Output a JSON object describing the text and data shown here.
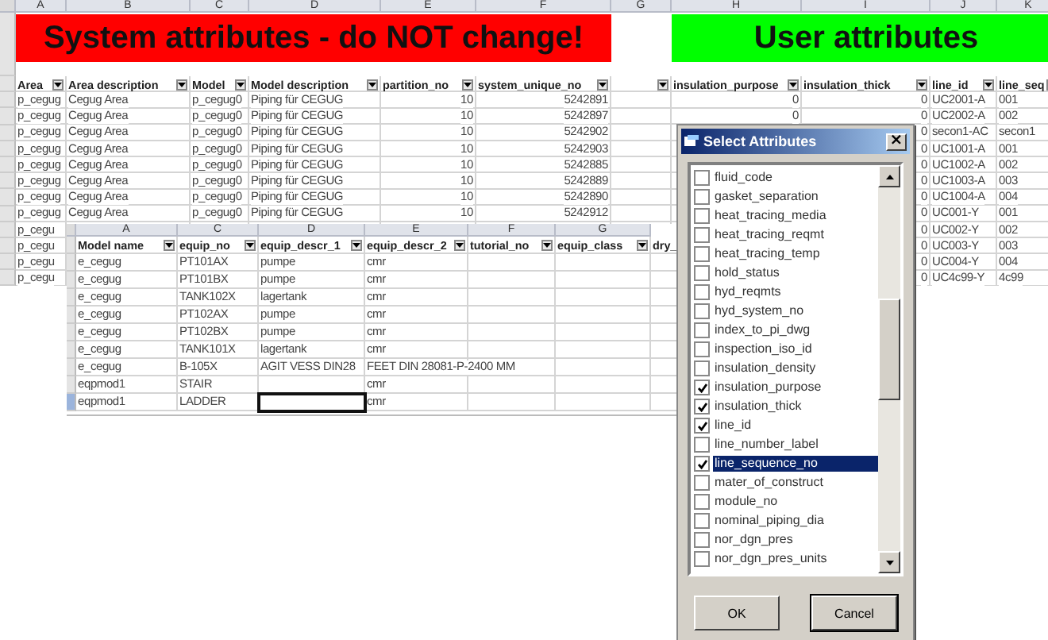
{
  "back_sheet": {
    "column_letters": [
      "A",
      "B",
      "C",
      "D",
      "E",
      "F",
      "G",
      "H",
      "I",
      "J",
      "K"
    ],
    "banners": [
      {
        "text": "System attributes - do NOT change!",
        "color": "#ff0000"
      },
      {
        "text": "User attributes",
        "color": "#00ff00"
      }
    ],
    "columns": [
      {
        "label": "Area"
      },
      {
        "label": "Area description"
      },
      {
        "label": "Model"
      },
      {
        "label": "Model description"
      },
      {
        "label": "partition_no"
      },
      {
        "label": "system_unique_no"
      },
      {},
      {
        "label": "insulation_purpose"
      },
      {
        "label": "insulation_thick"
      },
      {
        "label": "line_id"
      },
      {
        "label": "line_seq"
      }
    ],
    "rows": [
      {
        "cells": [
          "p_cegug",
          "Cegug Area",
          "p_cegug0",
          "Piping für CEGUG",
          "10",
          "5242891",
          null,
          "0",
          "0",
          "UC2001-A",
          "001"
        ]
      },
      {
        "cells": [
          "p_cegug",
          "Cegug Area",
          "p_cegug0",
          "Piping für CEGUG",
          "10",
          "5242897",
          null,
          "0",
          "0",
          "UC2002-A",
          "002"
        ]
      },
      {
        "cells": [
          "p_cegug",
          "Cegug Area",
          "p_cegug0",
          "Piping für CEGUG",
          "10",
          "5242902",
          null,
          null,
          "0",
          "secon1-AC",
          "secon1"
        ]
      },
      {
        "cells": [
          "p_cegug",
          "Cegug Area",
          "p_cegug0",
          "Piping für CEGUG",
          "10",
          "5242903",
          null,
          null,
          "0",
          "UC1001-A",
          "001"
        ]
      },
      {
        "cells": [
          "p_cegug",
          "Cegug Area",
          "p_cegug0",
          "Piping für CEGUG",
          "10",
          "5242885",
          null,
          null,
          "0",
          "UC1002-A",
          "002"
        ]
      },
      {
        "cells": [
          "p_cegug",
          "Cegug Area",
          "p_cegug0",
          "Piping für CEGUG",
          "10",
          "5242889",
          null,
          null,
          "0",
          "UC1003-A",
          "003"
        ]
      },
      {
        "cells": [
          "p_cegug",
          "Cegug Area",
          "p_cegug0",
          "Piping für CEGUG",
          "10",
          "5242890",
          null,
          null,
          "0",
          "UC1004-A",
          "004"
        ]
      },
      {
        "cells": [
          "p_cegug",
          "Cegug Area",
          "p_cegug0",
          "Piping für CEGUG",
          "10",
          "5242912",
          null,
          null,
          "0",
          "UC001-Y",
          "001"
        ]
      },
      {
        "cells": [
          "p_cegu",
          null,
          null,
          null,
          null,
          null,
          null,
          null,
          "0",
          "UC002-Y",
          "002"
        ]
      },
      {
        "cells": [
          "p_cegu",
          null,
          null,
          null,
          null,
          null,
          null,
          null,
          "0",
          "UC003-Y",
          "003"
        ]
      },
      {
        "cells": [
          "p_cegu",
          null,
          null,
          null,
          null,
          null,
          null,
          null,
          "0",
          "UC004-Y",
          "004"
        ]
      },
      {
        "cells": [
          "p_cegu",
          null,
          null,
          null,
          null,
          null,
          null,
          null,
          "0",
          "UC4c99-Y",
          "4c99"
        ]
      }
    ]
  },
  "front_sheet": {
    "column_letters": [
      "A",
      "C",
      "D",
      "E",
      "F",
      "G"
    ],
    "columns": [
      {
        "label": "Model name"
      },
      {
        "label": "equip_no"
      },
      {
        "label": "equip_descr_1"
      },
      {
        "label": "equip_descr_2"
      },
      {
        "label": "tutorial_no"
      },
      {
        "label": "equip_class"
      },
      {
        "label": "dry_"
      }
    ],
    "rows": [
      {
        "cells": [
          "e_cegug",
          "PT101AX",
          "pumpe",
          "cmr",
          null,
          null,
          null
        ]
      },
      {
        "cells": [
          "e_cegug",
          "PT101BX",
          "pumpe",
          "cmr",
          null,
          null,
          null
        ]
      },
      {
        "cells": [
          "e_cegug",
          "TANK102X",
          "lagertank",
          "cmr",
          null,
          null,
          null
        ]
      },
      {
        "cells": [
          "e_cegug",
          "PT102AX",
          "pumpe",
          "cmr",
          null,
          null,
          null
        ]
      },
      {
        "cells": [
          "e_cegug",
          "PT102BX",
          "pumpe",
          "cmr",
          null,
          null,
          null
        ]
      },
      {
        "cells": [
          "e_cegug",
          "TANK101X",
          "lagertank",
          "cmr",
          null,
          null,
          null
        ]
      },
      {
        "cells": [
          "e_cegug",
          "B-105X",
          "AGIT VESS DIN28",
          "FEET DIN 28081-P-2400 MM",
          null,
          null,
          null
        ]
      },
      {
        "cells": [
          "eqpmod1",
          "STAIR",
          null,
          "cmr",
          null,
          null,
          null
        ]
      },
      {
        "cells": [
          "eqpmod1",
          "LADDER",
          {
            "active": true
          },
          "cmr",
          null,
          null,
          null
        ]
      }
    ]
  },
  "dialog": {
    "title": "Select Attributes",
    "close": "×",
    "items": [
      {
        "label": "fluid_code",
        "checked": false,
        "selected": false
      },
      {
        "label": "gasket_separation",
        "checked": false,
        "selected": false
      },
      {
        "label": "heat_tracing_media",
        "checked": false,
        "selected": false
      },
      {
        "label": "heat_tracing_reqmt",
        "checked": false,
        "selected": false
      },
      {
        "label": "heat_tracing_temp",
        "checked": false,
        "selected": false
      },
      {
        "label": "hold_status",
        "checked": false,
        "selected": false
      },
      {
        "label": "hyd_reqmts",
        "checked": false,
        "selected": false
      },
      {
        "label": "hyd_system_no",
        "checked": false,
        "selected": false
      },
      {
        "label": "index_to_pi_dwg",
        "checked": false,
        "selected": false
      },
      {
        "label": "inspection_iso_id",
        "checked": false,
        "selected": false
      },
      {
        "label": "insulation_density",
        "checked": false,
        "selected": false
      },
      {
        "label": "insulation_purpose",
        "checked": true,
        "selected": false
      },
      {
        "label": "insulation_thick",
        "checked": true,
        "selected": false
      },
      {
        "label": "line_id",
        "checked": true,
        "selected": false
      },
      {
        "label": "line_number_label",
        "checked": false,
        "selected": false
      },
      {
        "label": "line_sequence_no",
        "checked": true,
        "selected": true
      },
      {
        "label": "mater_of_construct",
        "checked": false,
        "selected": false
      },
      {
        "label": "module_no",
        "checked": false,
        "selected": false
      },
      {
        "label": "nominal_piping_dia",
        "checked": false,
        "selected": false
      },
      {
        "label": "nor_dgn_pres",
        "checked": false,
        "selected": false
      },
      {
        "label": "nor_dgn_pres_units",
        "checked": false,
        "selected": false
      }
    ],
    "buttons": [
      "OK",
      "Cancel"
    ]
  }
}
